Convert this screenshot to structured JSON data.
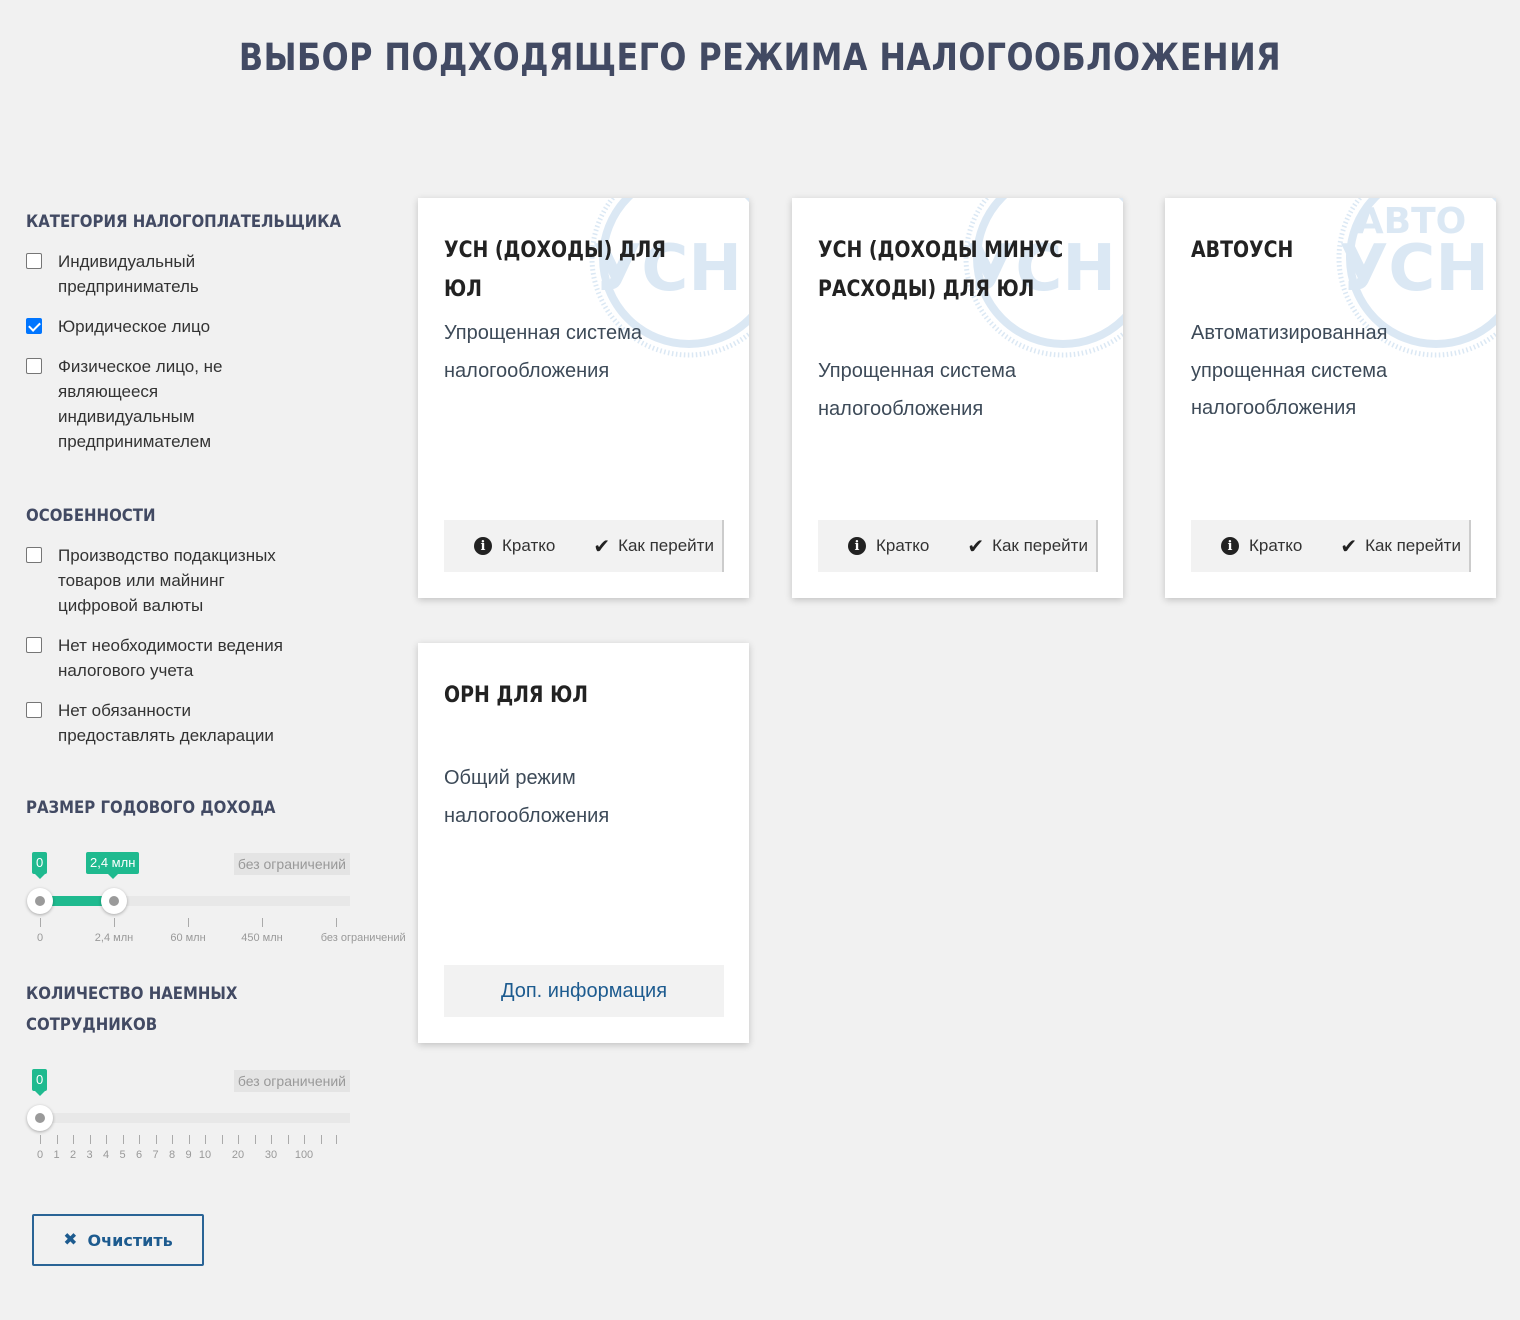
{
  "page": {
    "title": "ВЫБОР ПОДХОДЯЩЕГО РЕЖИМА НАЛОГООБЛОЖЕНИЯ"
  },
  "sidebar": {
    "category": {
      "title": "КАТЕГОРИЯ НАЛОГОПЛАТЕЛЬЩИКА",
      "options": [
        {
          "label_lines": [
            "Индивидуальный",
            "предприниматель"
          ],
          "checked": false
        },
        {
          "label_lines": [
            "Юридическое лицо"
          ],
          "checked": true
        },
        {
          "label_lines": [
            "Физическое лицо, не",
            "являющееся",
            "индивидуальным",
            "предпринимателем"
          ],
          "checked": false
        }
      ]
    },
    "features": {
      "title": "ОСОБЕННОСТИ",
      "options": [
        {
          "label_lines": [
            "Производство подакцизных",
            "товаров или майнинг",
            "цифровой валюты"
          ],
          "checked": false
        },
        {
          "label_lines": [
            "Нет необходимости ведения",
            "налогового учета"
          ],
          "checked": false
        },
        {
          "label_lines": [
            "Нет обязанности",
            "предоставлять декларации"
          ],
          "checked": false
        }
      ]
    },
    "income": {
      "title": "РАЗМЕР ГОДОВОГО ДОХОДА",
      "min_value": "0",
      "max_value": "2,4 млн",
      "limit_label": "без ограничений",
      "ticks": [
        "0",
        "2,4 млн",
        "60 млн",
        "450 млн",
        "без ограничений"
      ],
      "selected_range_index": [
        0,
        1
      ]
    },
    "employees": {
      "title_lines": [
        "КОЛИЧЕСТВО НАЕМНЫХ",
        "СОТРУДНИКОВ"
      ],
      "value": "0",
      "limit_label": "без ограничений",
      "ticks": [
        "0",
        "1",
        "2",
        "3",
        "4",
        "5",
        "6",
        "7",
        "8",
        "9",
        "10",
        "",
        "20",
        "",
        "30",
        "",
        "100",
        "",
        ""
      ],
      "selected_index": 0
    },
    "clear_button": "Очистить"
  },
  "cards": [
    {
      "title_lines": [
        "УСН (ДОХОДЫ) ДЛЯ ЮЛ"
      ],
      "desc_lines": [
        "Упрощенная система",
        "налогообложения"
      ],
      "watermark": "УСН",
      "watermark_top": "",
      "short_label": "Кратко",
      "move_label": "Как перейти"
    },
    {
      "title_lines": [
        "УСН (ДОХОДЫ МИНУС",
        "РАСХОДЫ) ДЛЯ ЮЛ"
      ],
      "desc_lines": [
        "Упрощенная система",
        "налогообложения"
      ],
      "watermark": "УСН",
      "watermark_top": "",
      "short_label": "Кратко",
      "move_label": "Как перейти"
    },
    {
      "title_lines": [
        "АВТОУСН"
      ],
      "desc_lines": [
        "Автоматизированная",
        "упрощенная система",
        "налогообложения"
      ],
      "watermark": "УСН",
      "watermark_top": "АВТО",
      "short_label": "Кратко",
      "move_label": "Как перейти"
    },
    {
      "title_lines": [
        "ОРН ДЛЯ ЮЛ"
      ],
      "desc_lines": [
        "Общий режим",
        "налогообложения"
      ],
      "more_label": "Доп. информация"
    }
  ],
  "colors": {
    "accent": "#1fba8f",
    "title": "#424a63",
    "link": "#1d5b8f",
    "checkbox": "#0075ff",
    "watermark": "#dbe8f4"
  }
}
